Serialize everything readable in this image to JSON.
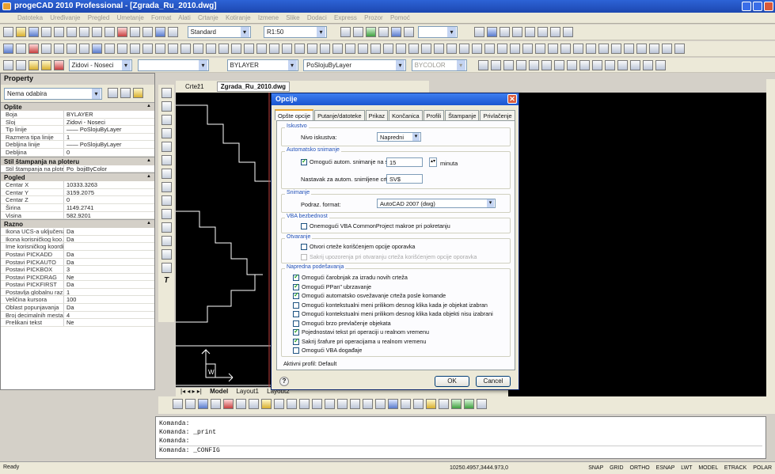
{
  "window": {
    "title": "progeCAD 2010 Professional - [Zgrada_Ru_2010.dwg]"
  },
  "menu": [
    "Datoteka",
    "Uređivanje",
    "Pregled",
    "Umetanje",
    "Format",
    "Alati",
    "Crtanje",
    "Kotiranje",
    "Izmene",
    "Slike",
    "Dodaci",
    "Express",
    "Prozor",
    "Pomoć"
  ],
  "toolbar": {
    "style_combo": "Standard",
    "dimstyle_combo": "R1:50",
    "layer_combo": "Zidovi - Noseci",
    "color_combo": "BYLAYER",
    "linetype_combo": "PoSlojuByLayer",
    "lineweight_combo": "BYCOLOR"
  },
  "property_panel": {
    "title": "Property",
    "selector": "Nema odabira",
    "sections": [
      {
        "name": "Opšte",
        "rows": [
          {
            "k": "Boja",
            "v": "BYLAYER"
          },
          {
            "k": "Sloj",
            "v": "Zidovi - Noseci"
          },
          {
            "k": "Tip linije",
            "v": "—— PoSlojuByLayer"
          },
          {
            "k": "Razmera tipa linije",
            "v": "1"
          },
          {
            "k": "Debljina linije",
            "v": "—— PoSlojuByLayer"
          },
          {
            "k": "Debljina",
            "v": "0"
          }
        ]
      },
      {
        "name": "Stil štampanja na ploteru",
        "rows": [
          {
            "k": "Stil štampanja na ploteru",
            "v": "Po_bojiByColor"
          }
        ]
      },
      {
        "name": "Pogled",
        "rows": [
          {
            "k": "Centar X",
            "v": "10333.3263"
          },
          {
            "k": "Centar Y",
            "v": "3159.2075"
          },
          {
            "k": "Centar Z",
            "v": "0"
          },
          {
            "k": "Širina",
            "v": "1149.2741"
          },
          {
            "k": "Visina",
            "v": "582.9201"
          }
        ]
      },
      {
        "name": "Razno",
        "rows": [
          {
            "k": "Ikona UCS-a uključena",
            "v": "Da"
          },
          {
            "k": "Ikona korisničkog koo...",
            "v": "Da"
          },
          {
            "k": "Ime korisničkog koordi...",
            "v": ""
          },
          {
            "k": "Postavi PICKADD",
            "v": "Da"
          },
          {
            "k": "Postavi PICKAUTO",
            "v": "Da"
          },
          {
            "k": "Postavi PICKBOX",
            "v": "3"
          },
          {
            "k": "Postavi PICKDRAG",
            "v": "Ne"
          },
          {
            "k": "Postavi PICKFIRST",
            "v": "Da"
          },
          {
            "k": "Postavlja globalnu raz...",
            "v": "1"
          },
          {
            "k": "Veličina kursora",
            "v": "100"
          },
          {
            "k": "Oblast popunjavanja",
            "v": "Da"
          },
          {
            "k": "Broj decimalnih mesta",
            "v": "4"
          },
          {
            "k": "Prelikani tekst",
            "v": "Ne"
          }
        ]
      }
    ]
  },
  "doc_tabs": [
    "Crtež1",
    "Zgrada_Ru_2010.dwg"
  ],
  "layout_tabs": [
    "Model",
    "Layout1",
    "Layout2"
  ],
  "dialog": {
    "title": "Opcije",
    "tabs": [
      "Opšte opcije",
      "Putanje/datoteke",
      "Prikaz",
      "Končanica",
      "Profili",
      "Štampanje",
      "Privlačenje"
    ],
    "iskustvo": {
      "label": "Iskustvo",
      "level_label": "Nivo iskustva:",
      "level_value": "Napredni"
    },
    "autosave": {
      "label": "Automatsko snimanje",
      "enable_label": "Omogući autom. snimanje na svakih:",
      "minutes_value": "15",
      "minutes_unit": "minuta",
      "ext_label": "Nastavak za autom. snimljene crteže:",
      "ext_value": "SV$"
    },
    "snimanje": {
      "label": "Snimanje",
      "format_label": "Podraz. format:",
      "format_value": "AutoCAD 2007 (dwg)"
    },
    "vba": {
      "label": "VBA bezbednost",
      "option": "Onemogući VBA CommonProject makroe pri pokretanju"
    },
    "otvaranje": {
      "label": "Otvaranje",
      "opt1": "Otvori crteže korišćenjem opcije oporavka",
      "opt2": "Sakrij upozorenja pri otvaranju crteža korišćenjem opcije oporavka"
    },
    "napredna": {
      "label": "Napredna podešavanja",
      "options": [
        {
          "text": "Omogući čarobnjak za izradu novih crteža",
          "checked": true
        },
        {
          "text": "Omogući PPan\" ubrzavanje",
          "checked": true
        },
        {
          "text": "Omogući automatsko osvežavanje crteža posle komande",
          "checked": true
        },
        {
          "text": "Omogući kontekstualni meni prilikom desnog klika kada je objekat izabran",
          "checked": false
        },
        {
          "text": "Omogući kontekstualni meni prilikom desnog klika kada objekti nisu izabrani",
          "checked": false
        },
        {
          "text": "Omogući brzo prevlačenje objekata",
          "checked": false
        },
        {
          "text": "Pojednostavi tekst pri operaciji u realnom vremenu",
          "checked": true
        },
        {
          "text": "Sakrij šrafure pri operacijama u realnom vremenu",
          "checked": true
        },
        {
          "text": "Omogući VBA događaje",
          "checked": false
        }
      ]
    },
    "active_profile": "Aktivni profil: Default",
    "ok": "OK",
    "cancel": "Cancel"
  },
  "command": {
    "lines": [
      "Komanda:",
      "Komanda: _print",
      "Komanda:"
    ],
    "current": "Komanda: _CONFIG"
  },
  "status": {
    "ready": "Ready",
    "coords": "10250.4957,3444.973,0",
    "modes": [
      "SNAP",
      "GRID",
      "ORTHO",
      "ESNAP",
      "LWT",
      "MODEL",
      "ETRACK",
      "POLAR"
    ]
  }
}
